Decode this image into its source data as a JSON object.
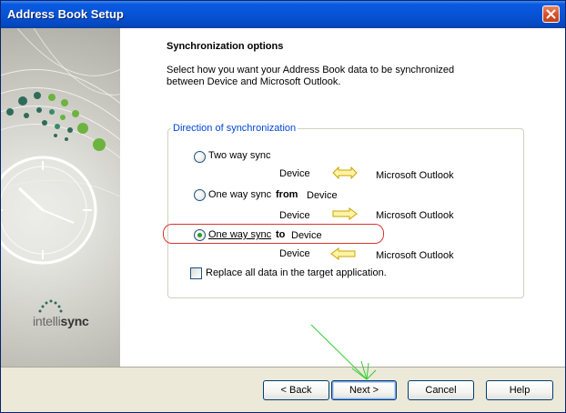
{
  "window": {
    "title": "Address Book Setup"
  },
  "sidebar": {
    "logo_prefix": "intelli",
    "logo_suffix": "sync"
  },
  "main": {
    "heading": "Synchronization options",
    "description": "Select how you want your Address Book data to be synchronized between Device and Microsoft Outlook."
  },
  "group": {
    "legend": "Direction of synchronization",
    "options": [
      {
        "label": "Two way sync",
        "bold_word": "",
        "target": "",
        "left": "Device",
        "right": "Microsoft Outlook",
        "selected": false,
        "arrow": "both-arrow-icon"
      },
      {
        "label": "One way sync",
        "bold_word": "from",
        "target": "Device",
        "left": "Device",
        "right": "Microsoft Outlook",
        "selected": false,
        "arrow": "right-arrow-icon"
      },
      {
        "label": "One way sync",
        "bold_word": "to",
        "target": "Device",
        "left": "Device",
        "right": "Microsoft Outlook",
        "selected": true,
        "arrow": "left-arrow-icon"
      }
    ],
    "replace_label": "Replace all data in the target application.",
    "replace_checked": false
  },
  "buttons": {
    "back": "< Back",
    "next": "Next >",
    "cancel": "Cancel",
    "help": "Help"
  },
  "colors": {
    "titlebar": "#0653d6",
    "arrow_fill": "#fff3a6",
    "arrow_stroke": "#c8a400",
    "highlight": "#dd3333",
    "annotation_arrow": "#33cc33"
  }
}
